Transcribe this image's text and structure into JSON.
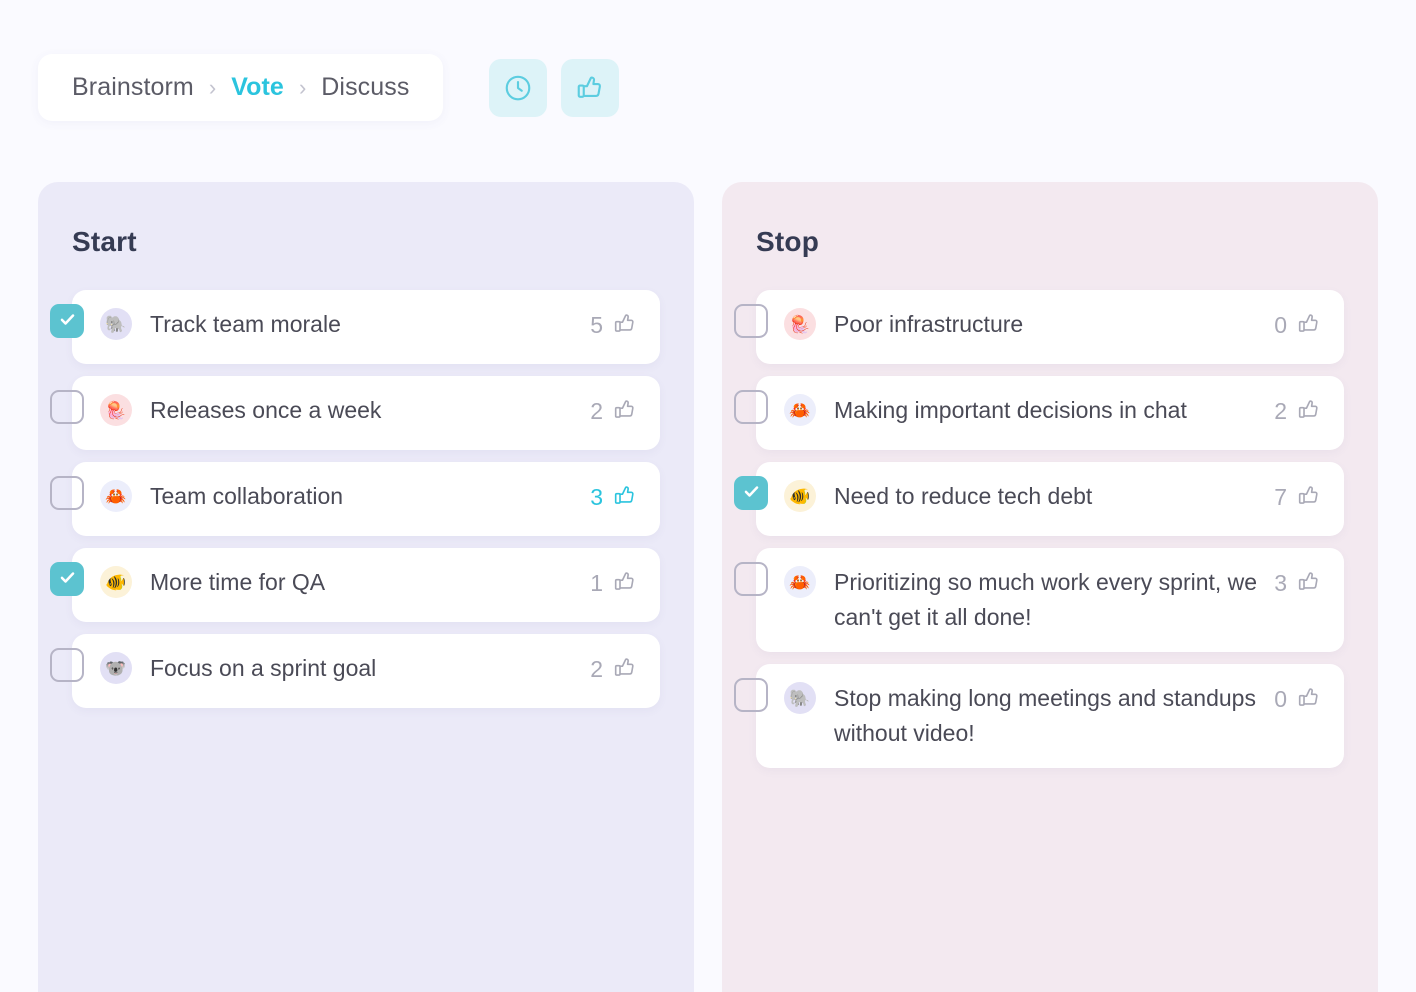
{
  "breadcrumb": {
    "items": [
      {
        "label": "Brainstorm",
        "active": false
      },
      {
        "label": "Vote",
        "active": true
      },
      {
        "label": "Discuss",
        "active": false
      }
    ],
    "separator": "›"
  },
  "toolbar": {
    "timer_button": "timer-button",
    "vote_button": "vote-button",
    "accent_color": "#2bc4de",
    "button_bg": "#ddf3f8"
  },
  "columns": [
    {
      "title": "Start",
      "bg": "#ebeaf8",
      "cards": [
        {
          "text": "Track team morale",
          "votes": "5",
          "checked": true,
          "avatar": "elephant-avatar",
          "emoji": "🐘",
          "avatar_class": "av-lav",
          "highlight": false
        },
        {
          "text": "Releases once a week",
          "votes": "2",
          "checked": false,
          "avatar": "jellyfish-avatar",
          "emoji": "🪼",
          "avatar_class": "av-pink",
          "highlight": false
        },
        {
          "text": "Team collaboration",
          "votes": "3",
          "checked": false,
          "avatar": "crab-avatar",
          "emoji": "🦀",
          "avatar_class": "av-blue",
          "highlight": true
        },
        {
          "text": "More time for QA",
          "votes": "1",
          "checked": true,
          "avatar": "clownfish-avatar",
          "emoji": "🐠",
          "avatar_class": "av-cream",
          "highlight": false
        },
        {
          "text": "Focus on a sprint goal",
          "votes": "2",
          "checked": false,
          "avatar": "koala-avatar",
          "emoji": "🐨",
          "avatar_class": "av-lav",
          "highlight": false
        }
      ]
    },
    {
      "title": "Stop",
      "bg": "#f3e9f0",
      "cards": [
        {
          "text": "Poor infrastructure",
          "votes": "0",
          "checked": false,
          "avatar": "jellyfish-avatar",
          "emoji": "🪼",
          "avatar_class": "av-pink",
          "highlight": false
        },
        {
          "text": "Making important decisions in chat",
          "votes": "2",
          "checked": false,
          "avatar": "crab-avatar",
          "emoji": "🦀",
          "avatar_class": "av-blue",
          "highlight": false
        },
        {
          "text": "Need to reduce tech debt",
          "votes": "7",
          "checked": true,
          "avatar": "clownfish-avatar",
          "emoji": "🐠",
          "avatar_class": "av-cream",
          "highlight": false
        },
        {
          "text": "Prioritizing so much work every sprint, we can't get it all done!",
          "votes": "3",
          "checked": false,
          "avatar": "crab-avatar",
          "emoji": "🦀",
          "avatar_class": "av-blue",
          "highlight": false
        },
        {
          "text": "Stop making long meetings and standups without video!",
          "votes": "0",
          "checked": false,
          "avatar": "elephant-avatar",
          "emoji": "🐘",
          "avatar_class": "av-lav",
          "highlight": false
        }
      ]
    }
  ]
}
